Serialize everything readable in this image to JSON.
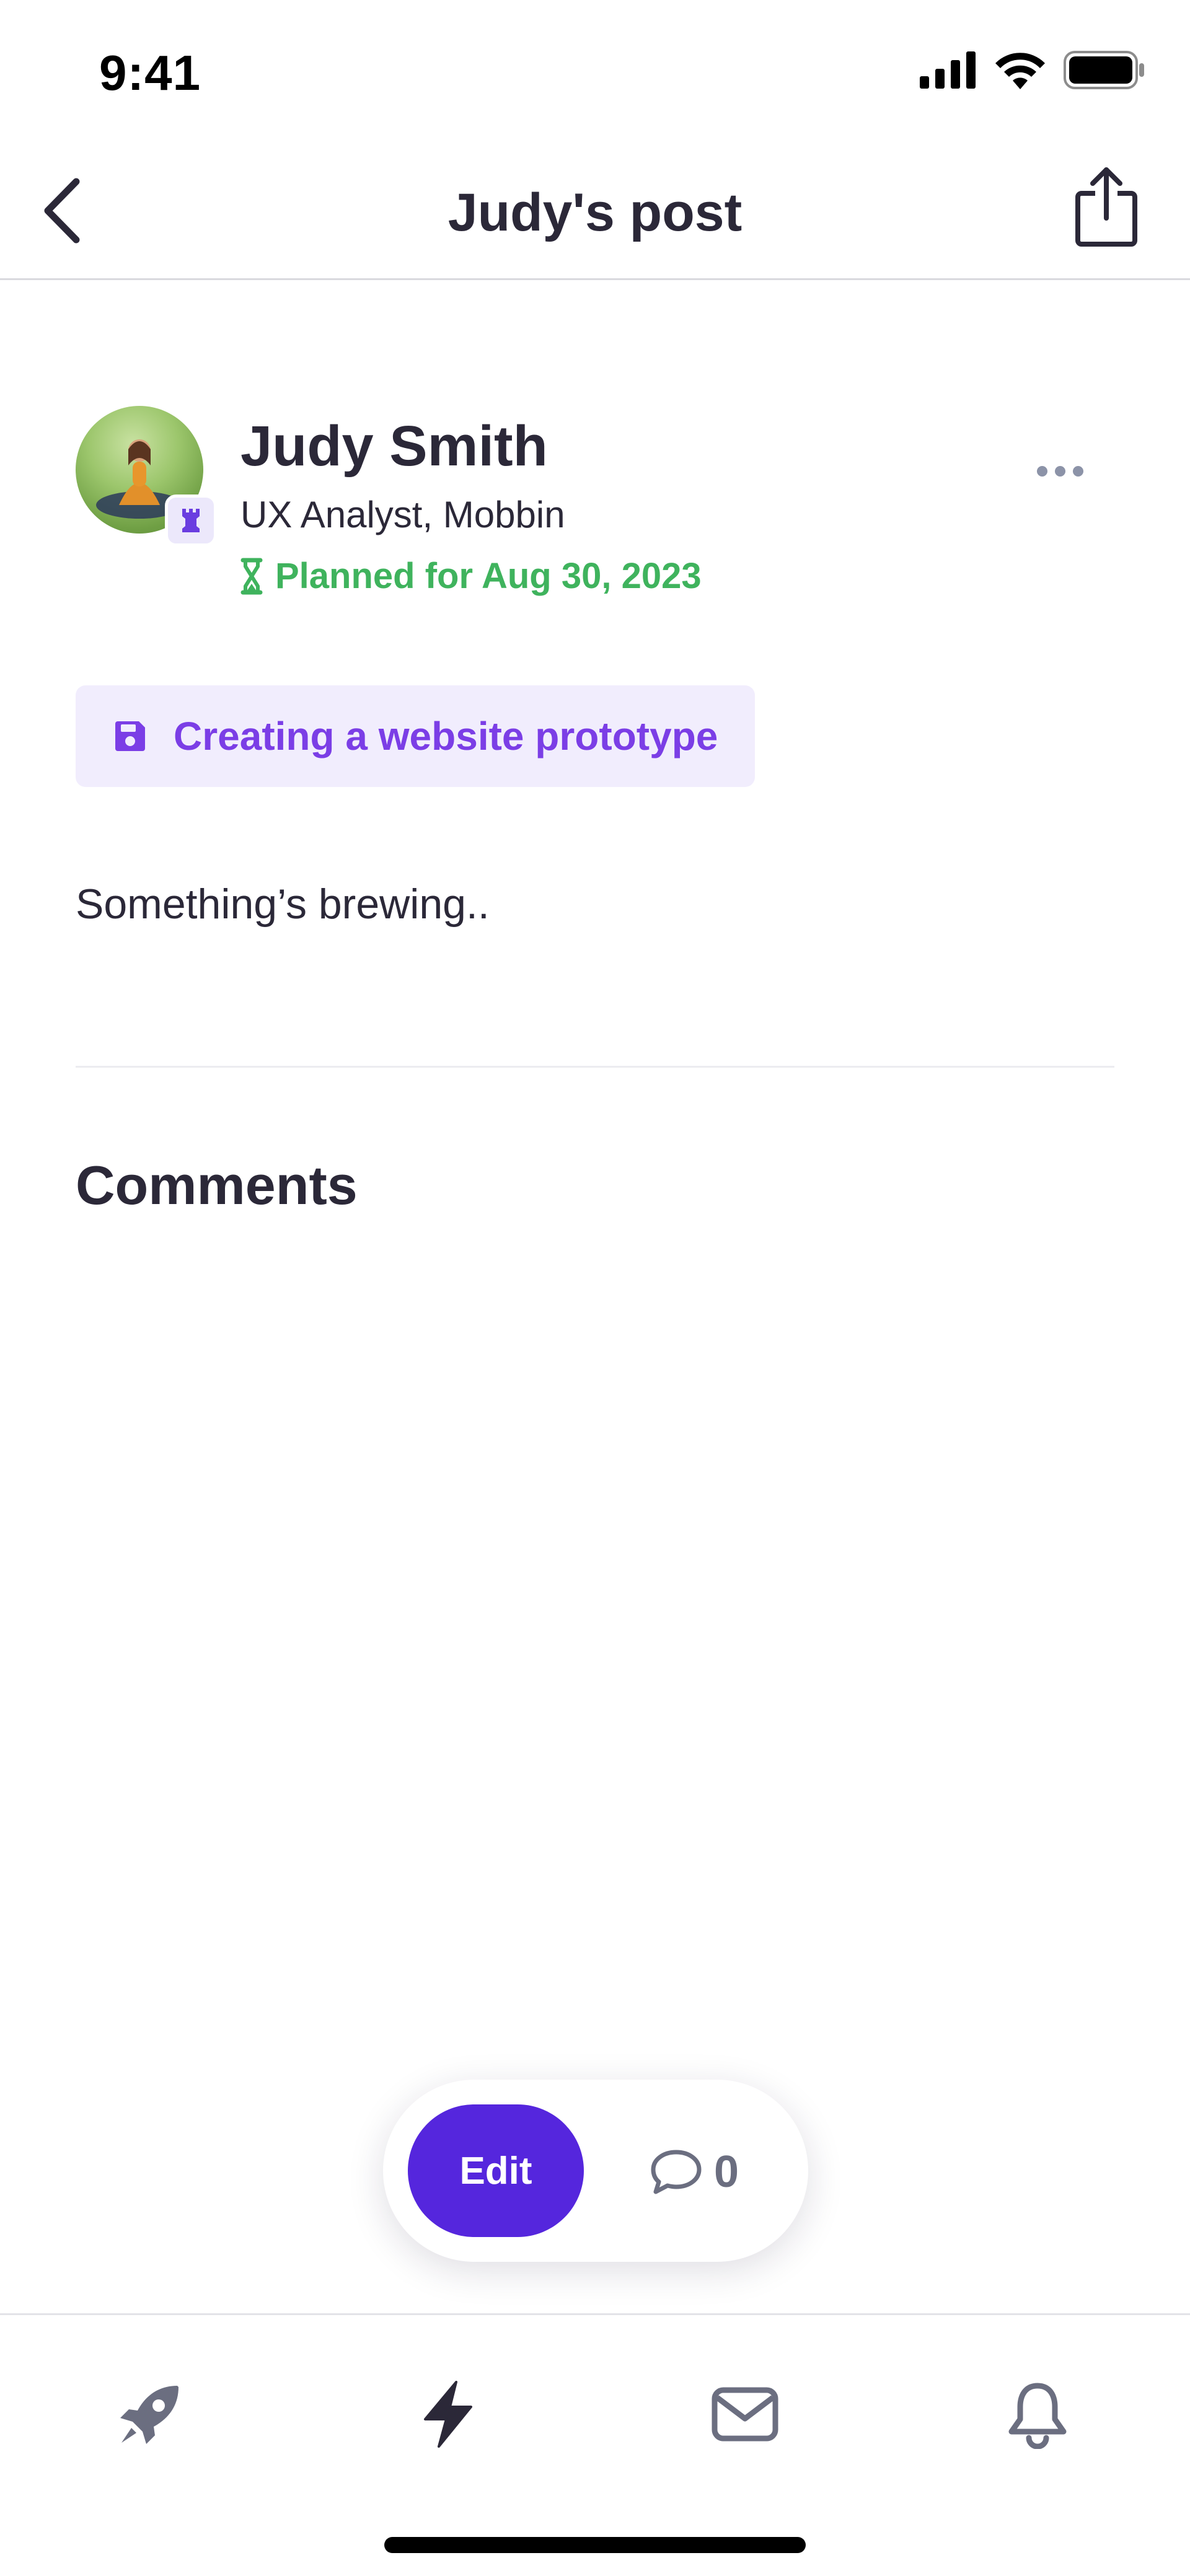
{
  "status_bar": {
    "time": "9:41"
  },
  "nav": {
    "title": "Judy's post",
    "back_icon": "chevron-left-icon",
    "share_icon": "share-icon"
  },
  "post": {
    "author": {
      "name": "Judy Smith",
      "role": "UX Analyst, Mobbin",
      "badge_icon": "rook-icon"
    },
    "planned_label": "Planned for Aug 30, 2023",
    "tag": {
      "icon": "floppy-disk-icon",
      "label": "Creating a website prototype"
    },
    "body": "Something’s brewing..",
    "comments_heading": "Comments"
  },
  "actions": {
    "edit_label": "Edit",
    "comment_count": "0"
  },
  "tabbar": {
    "items": [
      {
        "icon": "rocket-icon"
      },
      {
        "icon": "lightning-icon"
      },
      {
        "icon": "mail-icon"
      },
      {
        "icon": "bell-icon"
      }
    ]
  },
  "colors": {
    "accent_purple": "#5526dd",
    "tag_text": "#7b3ee6",
    "tag_background": "#f1edfd",
    "planned_green": "#3fb35d",
    "text_dark": "#2b2838"
  }
}
